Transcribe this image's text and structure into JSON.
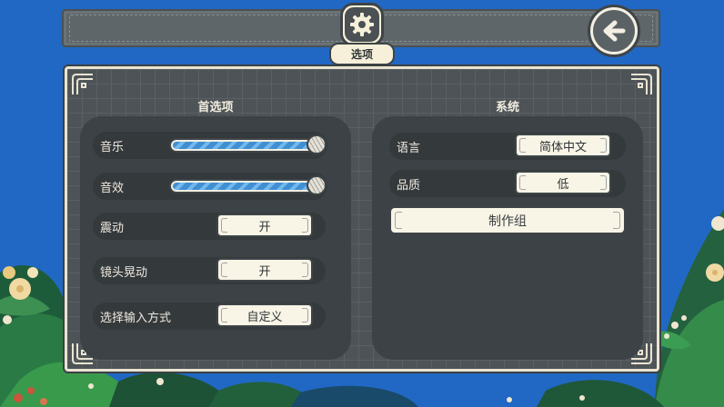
{
  "header": {
    "title": "选项",
    "settings_icon": "gear-icon",
    "back_icon": "arrow-left-icon"
  },
  "preferences": {
    "title": "首选项",
    "music": {
      "label": "音乐",
      "value": 1.0
    },
    "sfx": {
      "label": "音效",
      "value": 1.0
    },
    "vibration": {
      "label": "震动",
      "value": "开"
    },
    "camera_shake": {
      "label": "镜头晃动",
      "value": "开"
    },
    "input_method": {
      "label": "选择输入方式",
      "value": "自定义"
    }
  },
  "system": {
    "title": "系统",
    "language": {
      "label": "语言",
      "value": "简体中文"
    },
    "quality": {
      "label": "品质",
      "value": "低"
    },
    "credits_label": "制作组"
  },
  "colors": {
    "background": "#2168c4",
    "panel": "#4d5356",
    "slider_fill": "#3f8fd2",
    "cream": "#f8f4e6"
  }
}
